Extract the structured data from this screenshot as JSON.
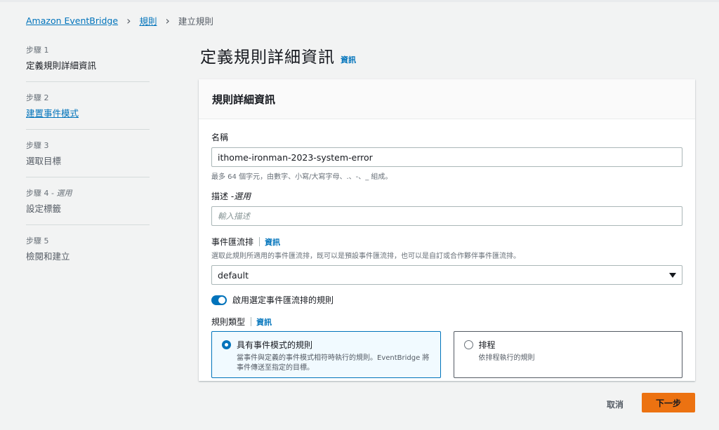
{
  "breadcrumb": {
    "items": [
      "Amazon EventBridge",
      "規則",
      "建立規則"
    ]
  },
  "steps": [
    {
      "num": "步驟 1",
      "optional": "",
      "name": "定義規則詳細資訊"
    },
    {
      "num": "步驟 2",
      "optional": "",
      "name": "建置事件模式"
    },
    {
      "num": "步驟 3",
      "optional": "",
      "name": "選取目標"
    },
    {
      "num": "步驟 4 - ",
      "optional": "選用",
      "name": "設定標籤"
    },
    {
      "num": "步驟 5",
      "optional": "",
      "name": "檢閱和建立"
    }
  ],
  "page": {
    "title": "定義規則詳細資訊",
    "info": "資訊"
  },
  "card": {
    "title": "規則詳細資訊",
    "name_label": "名稱",
    "name_value": "ithome-ironman-2023-system-error",
    "name_hint": "最多 64 個字元，由數字、小寫/大寫字母、.、-、_ 組成。",
    "desc_label": "描述 - ",
    "desc_optional": "選用",
    "desc_placeholder": "輸入描述",
    "bus_label": "事件匯流排",
    "bus_info": "資訊",
    "bus_desc": "選取此規則所適用的事件匯流排，既可以是預設事件匯流排，也可以是自訂或合作夥伴事件匯流排。",
    "bus_value": "default",
    "toggle_label": "啟用選定事件匯流排的規則",
    "rule_type_label": "規則類型",
    "rule_type_info": "資訊",
    "tile1_title": "具有事件模式的規則",
    "tile1_desc": "當事件與定義的事件模式相符時執行的規則。EventBridge 將事件傳送至指定的目標。",
    "tile2_title": "排程",
    "tile2_desc": "依排程執行的規則"
  },
  "footer": {
    "cancel": "取消",
    "next": "下一步"
  },
  "colors": {
    "accent": "#0073bb",
    "primary_button": "#ec7211"
  }
}
